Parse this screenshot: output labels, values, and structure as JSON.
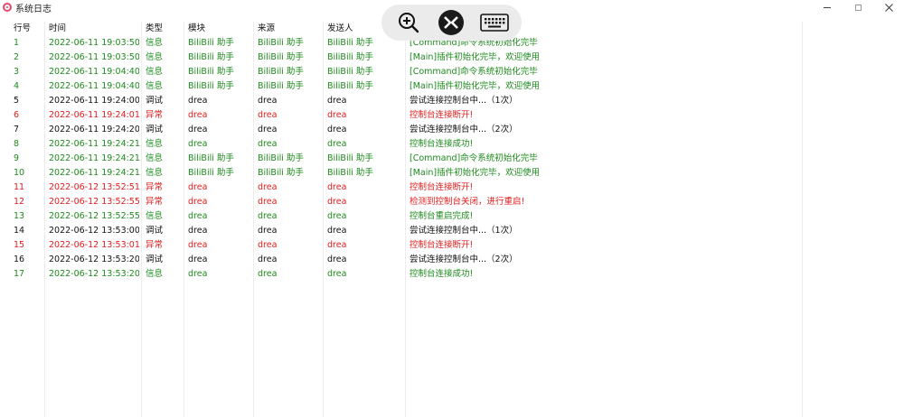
{
  "window": {
    "title": "系统日志",
    "icon": "app-logo-icon",
    "controls": [
      "minimize-icon",
      "maximize-icon",
      "close-icon"
    ]
  },
  "remote_toolbar": {
    "buttons": [
      "zoom-in-icon",
      "remote-desktop-icon",
      "keyboard-icon"
    ]
  },
  "colors": {
    "info": "#1c8a1c",
    "error": "#e01c1c",
    "debug": "#111111"
  },
  "table": {
    "columns": [
      "行号",
      "时间",
      "类型",
      "模块",
      "来源",
      "发送人",
      "消息"
    ],
    "rows": [
      {
        "level": "info",
        "cells": [
          "1",
          "2022-06-11 19:03:50",
          "信息",
          "BiliBili 助手",
          "BiliBili 助手",
          "BiliBili 助手",
          "[Command]命令系统初始化完毕"
        ]
      },
      {
        "level": "info",
        "cells": [
          "2",
          "2022-06-11 19:03:50",
          "信息",
          "BiliBili 助手",
          "BiliBili 助手",
          "BiliBili 助手",
          "[Main]插件初始化完毕，欢迎使用"
        ]
      },
      {
        "level": "info",
        "cells": [
          "3",
          "2022-06-11 19:04:40",
          "信息",
          "BiliBili 助手",
          "BiliBili 助手",
          "BiliBili 助手",
          "[Command]命令系统初始化完毕"
        ]
      },
      {
        "level": "info",
        "cells": [
          "4",
          "2022-06-11 19:04:40",
          "信息",
          "BiliBili 助手",
          "BiliBili 助手",
          "BiliBili 助手",
          "[Main]插件初始化完毕，欢迎使用"
        ]
      },
      {
        "level": "debug",
        "cells": [
          "5",
          "2022-06-11 19:24:00",
          "调试",
          "drea",
          "drea",
          "drea",
          "尝试连接控制台中...（1次）"
        ]
      },
      {
        "level": "error",
        "cells": [
          "6",
          "2022-06-11 19:24:01",
          "异常",
          "drea",
          "drea",
          "drea",
          "控制台连接断开!"
        ]
      },
      {
        "level": "debug",
        "cells": [
          "7",
          "2022-06-11 19:24:20",
          "调试",
          "drea",
          "drea",
          "drea",
          "尝试连接控制台中...（2次）"
        ]
      },
      {
        "level": "info",
        "cells": [
          "8",
          "2022-06-11 19:24:21",
          "信息",
          "drea",
          "drea",
          "drea",
          "控制台连接成功!"
        ]
      },
      {
        "level": "info",
        "cells": [
          "9",
          "2022-06-11 19:24:21",
          "信息",
          "BiliBili 助手",
          "BiliBili 助手",
          "BiliBili 助手",
          "[Command]命令系统初始化完毕"
        ]
      },
      {
        "level": "info",
        "cells": [
          "10",
          "2022-06-11 19:24:21",
          "信息",
          "BiliBili 助手",
          "BiliBili 助手",
          "BiliBili 助手",
          "[Main]插件初始化完毕，欢迎使用"
        ]
      },
      {
        "level": "error",
        "cells": [
          "11",
          "2022-06-12 13:52:51",
          "异常",
          "drea",
          "drea",
          "drea",
          "控制台连接断开!"
        ]
      },
      {
        "level": "error",
        "cells": [
          "12",
          "2022-06-12 13:52:55",
          "异常",
          "drea",
          "drea",
          "drea",
          "检测到控制台关闭，进行重启!"
        ]
      },
      {
        "level": "info",
        "cells": [
          "13",
          "2022-06-12 13:52:55",
          "信息",
          "drea",
          "drea",
          "drea",
          "控制台重启完成!"
        ]
      },
      {
        "level": "debug",
        "cells": [
          "14",
          "2022-06-12 13:53:00",
          "调试",
          "drea",
          "drea",
          "drea",
          "尝试连接控制台中...（1次）"
        ]
      },
      {
        "level": "error",
        "cells": [
          "15",
          "2022-06-12 13:53:01",
          "异常",
          "drea",
          "drea",
          "drea",
          "控制台连接断开!"
        ]
      },
      {
        "level": "debug",
        "cells": [
          "16",
          "2022-06-12 13:53:20",
          "调试",
          "drea",
          "drea",
          "drea",
          "尝试连接控制台中...（2次）"
        ]
      },
      {
        "level": "info",
        "cells": [
          "17",
          "2022-06-12 13:53:20",
          "信息",
          "drea",
          "drea",
          "drea",
          "控制台连接成功!"
        ]
      }
    ]
  }
}
